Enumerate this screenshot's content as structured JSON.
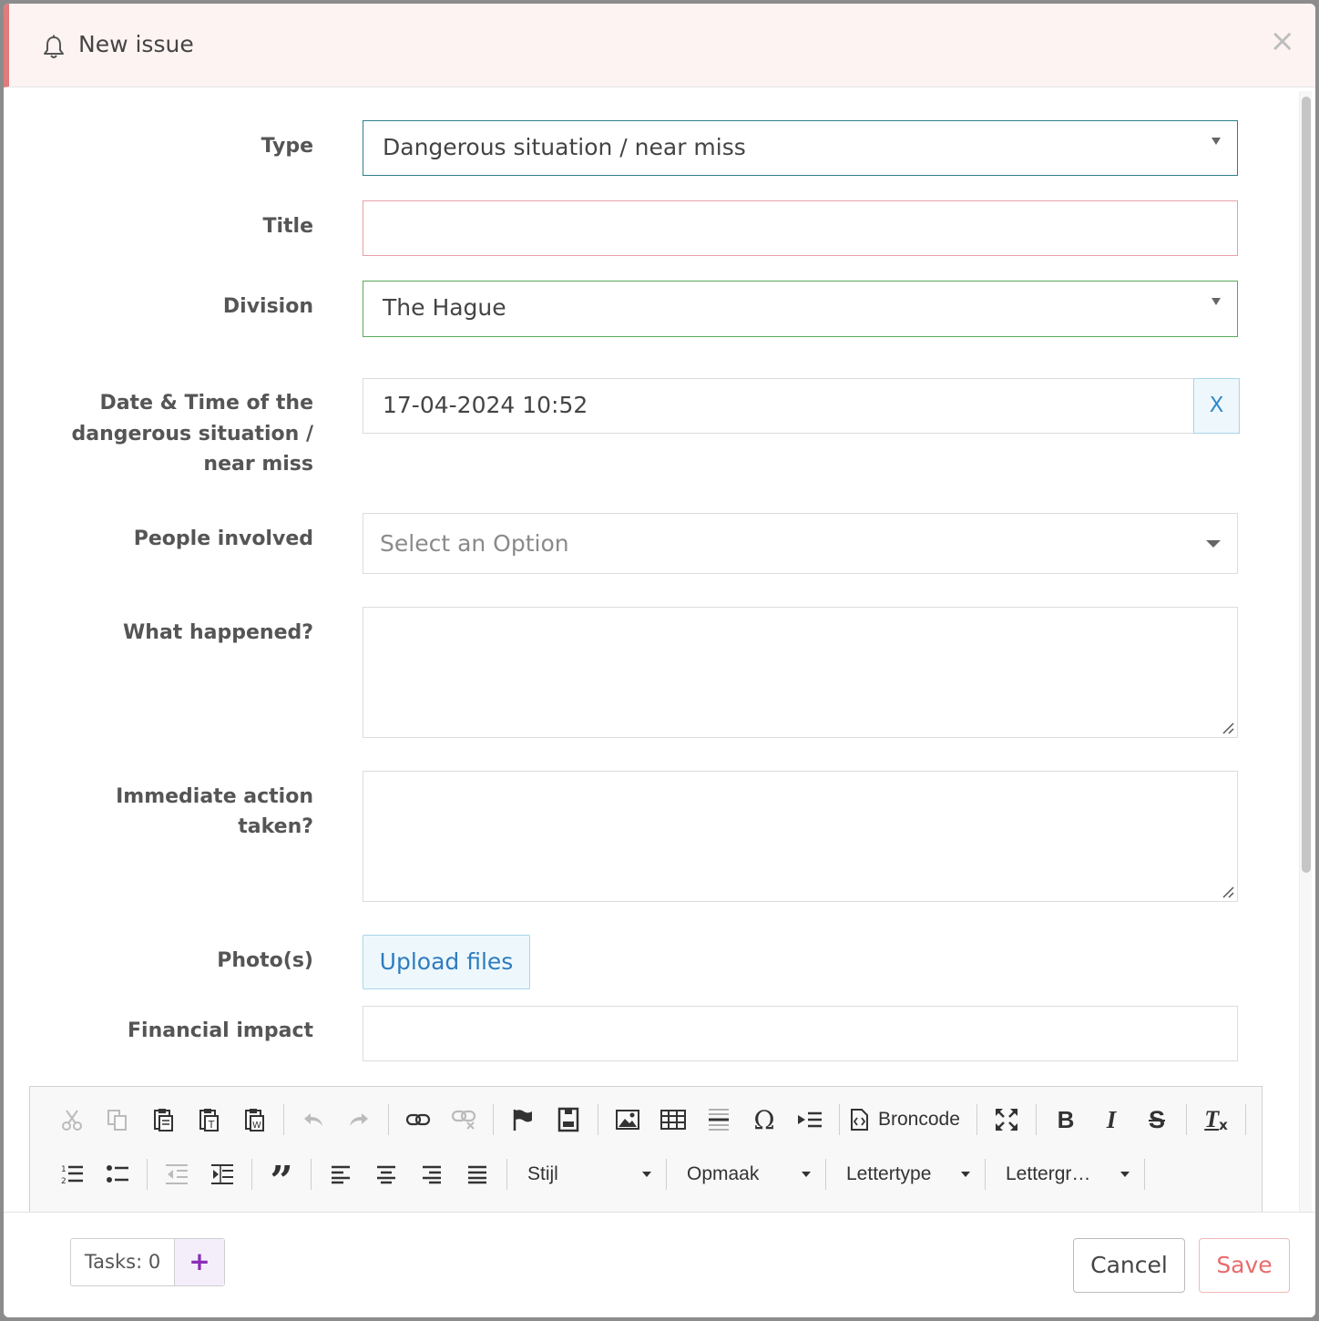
{
  "header": {
    "title": "New issue",
    "close_label": "×"
  },
  "form": {
    "type": {
      "label": "Type",
      "value": "Dangerous situation / near miss"
    },
    "title": {
      "label": "Title",
      "value": ""
    },
    "division": {
      "label": "Division",
      "value": "The Hague"
    },
    "datetime": {
      "label_line1": "Date & Time of the",
      "label_line2": "dangerous situation /",
      "label_line3": "near miss",
      "value": "17-04-2024 10:52",
      "clear_label": "X"
    },
    "people": {
      "label": "People involved",
      "placeholder": "Select an Option"
    },
    "what_happened": {
      "label": "What happened?",
      "value": ""
    },
    "immediate_action": {
      "label_line1": "Immediate action",
      "label_line2": "taken?",
      "value": ""
    },
    "photos": {
      "label": "Photo(s)",
      "button": "Upload files"
    },
    "financial": {
      "label": "Financial impact",
      "value": ""
    }
  },
  "editor": {
    "source_label": "Broncode",
    "combos": [
      "Stijl",
      "Opmaak",
      "Lettertype",
      "Lettergr…"
    ],
    "icons_row1": [
      "cut-icon",
      "copy-icon",
      "paste-icon",
      "paste-text-icon",
      "paste-word-icon",
      "undo-icon",
      "redo-icon",
      "link-icon",
      "unlink-icon",
      "anchor-icon",
      "iframe-icon",
      "image-icon",
      "table-icon",
      "horizontal-rule-icon",
      "special-char-icon",
      "blockquote-indent-icon",
      "source-icon",
      "maximize-icon",
      "bold-icon",
      "italic-icon",
      "strike-icon",
      "remove-format-icon"
    ],
    "icons_row2": [
      "numbered-list-icon",
      "bullet-list-icon",
      "outdent-icon",
      "indent-icon",
      "quote-icon",
      "align-left-icon",
      "align-center-icon",
      "align-right-icon",
      "justify-icon"
    ]
  },
  "footer": {
    "tasks_label": "Tasks: 0",
    "tasks_add": "+",
    "cancel": "Cancel",
    "save": "Save"
  },
  "colors": {
    "accent_blue": "#2e8ac9",
    "save_red": "#e86b6b",
    "header_bg": "#fdf3f3",
    "type_border": "#2f7f86",
    "title_border": "#e8a0a6",
    "division_border": "#5aa85a"
  }
}
